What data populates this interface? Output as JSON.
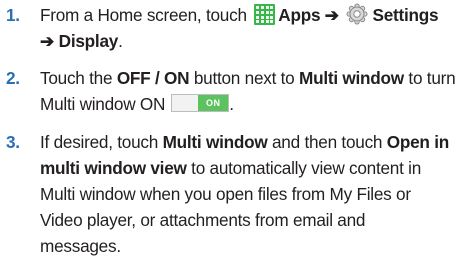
{
  "steps": [
    {
      "number": "1.",
      "l1_a": "From a Home screen, touch",
      "l1_b": "Apps",
      "l1_arrow": "➔",
      "l1_c": "Settings",
      "l2": "➔ Display",
      "l2_end": "."
    },
    {
      "number": "2.",
      "l1_a": "Touch the ",
      "l1_b": "OFF / ON",
      "l1_c": " button next to ",
      "l1_d": "Multi window",
      "l1_e": " to turn",
      "l2_a": "Multi window ON",
      "toggle_label": "ON",
      "l2_end": "."
    },
    {
      "number": "3.",
      "l1_a": "If desired, touch ",
      "l1_b": "Multi window",
      "l1_c": " and then touch ",
      "l1_d": "Open in",
      "l2_a": "multi window view",
      "l2_b": " to automatically view content in",
      "l3": "Multi window when you open files from My Files or",
      "l4": "Video player, or attachments from email and",
      "l5": "messages."
    }
  ],
  "icons": {
    "apps": "apps-grid-icon",
    "settings": "gear-icon"
  },
  "colors": {
    "step_number": "#2a6fb5",
    "apps_icon": "#39b54a",
    "toggle_on": "#5cc25f",
    "text": "#231f20"
  }
}
